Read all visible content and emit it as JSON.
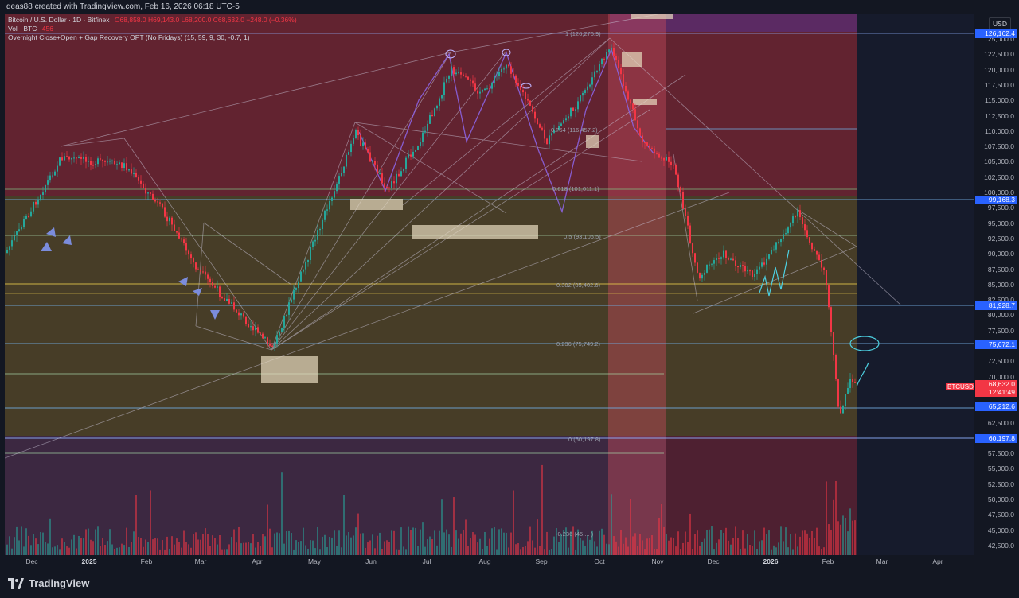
{
  "header": {
    "caption": "deas88 created with TradingView.com, Feb 16, 2026 06:18 UTC-5"
  },
  "legend": {
    "symbol": "Bitcoin / U.S. Dollar · 1D · Bitfinex",
    "ohlc": "O68,858.0  H69,143.0  L68,200.0  C68,632.0  −248.0 (−0.36%)",
    "vol_label": "Vol · BTC",
    "vol_value": "456",
    "indicator": "Overnight Close+Open + Gap Recovery OPT (No Fridays) (15, 59, 9, 30, -0.7, 1)"
  },
  "price_scale": {
    "currency": "USD",
    "ticks": [
      "125,000.0",
      "122,500.0",
      "120,000.0",
      "117,500.0",
      "115,000.0",
      "112,500.0",
      "110,000.0",
      "107,500.0",
      "105,000.0",
      "102,500.0",
      "100,000.0",
      "97,500.0",
      "95,000.0",
      "92,500.0",
      "90,000.0",
      "87,500.0",
      "85,000.0",
      "82,500.0",
      "80,000.0",
      "77,500.0",
      "75,000.0",
      "72,500.0",
      "70,000.0",
      "67,500.0",
      "65,000.0",
      "62,500.0",
      "60,000.0",
      "57,500.0",
      "55,000.0",
      "52,500.0",
      "50,000.0",
      "47,500.0",
      "45,000.0",
      "42,500.0"
    ],
    "labels": [
      {
        "value": "126,162.4",
        "color": "#2962ff"
      },
      {
        "value": "99,168.3",
        "color": "#2962ff"
      },
      {
        "value": "81,928.7",
        "color": "#2962ff"
      },
      {
        "value": "75,672.1",
        "color": "#2962ff"
      },
      {
        "value": "68,632.0",
        "color": "#f23645"
      },
      {
        "value": "12:41:49",
        "color": "#f23645"
      },
      {
        "value": "65,212.6",
        "color": "#2962ff"
      },
      {
        "value": "60,197.8",
        "color": "#2962ff"
      }
    ],
    "symbol_tag": "BTCUSD"
  },
  "time_scale": {
    "ticks": [
      {
        "label": "Dec",
        "bold": false
      },
      {
        "label": "2025",
        "bold": true
      },
      {
        "label": "Feb",
        "bold": false
      },
      {
        "label": "Mar",
        "bold": false
      },
      {
        "label": "Apr",
        "bold": false
      },
      {
        "label": "May",
        "bold": false
      },
      {
        "label": "Jun",
        "bold": false
      },
      {
        "label": "Jul",
        "bold": false
      },
      {
        "label": "Aug",
        "bold": false
      },
      {
        "label": "Sep",
        "bold": false
      },
      {
        "label": "Oct",
        "bold": false
      },
      {
        "label": "Nov",
        "bold": false
      },
      {
        "label": "Dec",
        "bold": false
      },
      {
        "label": "2026",
        "bold": true
      },
      {
        "label": "Feb",
        "bold": false
      },
      {
        "label": "Mar",
        "bold": false
      },
      {
        "label": "Apr",
        "bold": false
      }
    ]
  },
  "fib_levels": [
    {
      "label": "1 (126,276.9)"
    },
    {
      "label": "0.764 (116,457.2)"
    },
    {
      "label": "0.618 (101,011.1)"
    },
    {
      "label": "0.5 (93,106.5)"
    },
    {
      "label": "0.382 (85,402.6)"
    },
    {
      "label": "0.236 (75,749.2)"
    },
    {
      "label": "0 (60,197.8)"
    },
    {
      "label": "-0.236 (45,... )"
    }
  ],
  "footer": {
    "brand": "TradingView"
  },
  "colors": {
    "up": "#26a69a",
    "down": "#f23645",
    "accent": "#2962ff"
  }
}
